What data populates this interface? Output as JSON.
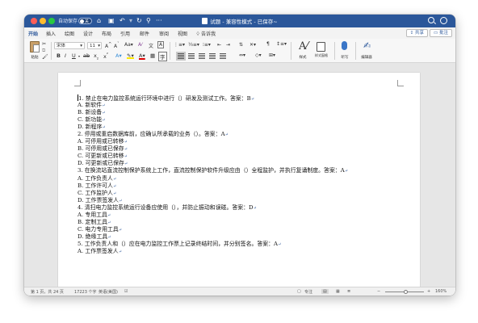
{
  "titlebar": {
    "autosave_label": "自动保存",
    "autosave_state": "关",
    "doc_title": "试题 - 兼容性模式 - 已保存~"
  },
  "tabs": [
    "开始",
    "插入",
    "绘图",
    "设计",
    "布局",
    "引用",
    "邮件",
    "审阅",
    "视图",
    "告诉我"
  ],
  "active_tab": "开始",
  "header_buttons": {
    "share": "共享",
    "comment": "批注"
  },
  "toolbar": {
    "paste_label": "粘贴",
    "font_name": "宋体",
    "font_size": "11",
    "styles_label": "样式",
    "styles_pane_label": "样式窗格",
    "dictate_label": "听写",
    "editor_label": "编辑器"
  },
  "document": {
    "lines": [
      "1. 禁止在电力监控系统运行环境中进行（）研发及测试工作。答案：B",
      "A. 新软件",
      "B. 新设备",
      "C. 新功能",
      "D. 新程序",
      "2. 停用或重启数据库前，应确认所承载的业务（）。答案：A",
      "A. 可停用或已转移",
      "B. 可停用或已保存",
      "C. 可更新或已转移",
      "D. 可更新或已保存",
      "3. 在换流站直流控制保护系统上工作，直流控制保护软件升级应由（）全程监护，并执行复诵制度。答案：A",
      "A. 工作负责人",
      "B. 工作许可人",
      "C. 工作监护人",
      "D. 工作票签发人",
      "4. 清扫电力监控系统运行设备应使用（），并防止振动和误碰。答案：D",
      "A. 专用工具",
      "B. 定制工具",
      "C. 电力专用工具",
      "D. 绝缘工具",
      "5. 工作负责人和（）应在电力监控工作票上记录终结时间，并分别签名。答案：A",
      "A. 工作票签发人"
    ]
  },
  "statusbar": {
    "page_info": "第 1 页，共 24 页",
    "word_count": "17223 个字",
    "language": "英语(美国)",
    "focus_label": "专注",
    "zoom": "160%"
  },
  "colors": {
    "accent": "#2b579a",
    "paragraph_mark": "#2b579a"
  }
}
